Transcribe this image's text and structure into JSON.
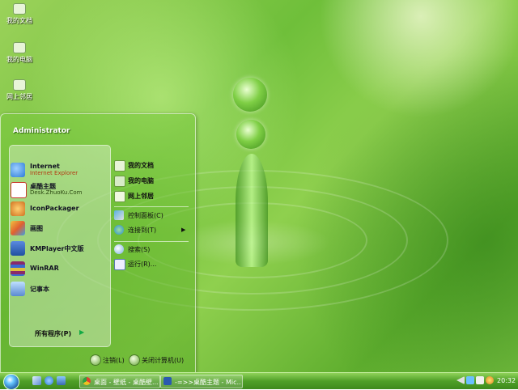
{
  "desktop_icons": [
    {
      "label": "我的文档",
      "icon": "my-documents-icon"
    },
    {
      "label": "我的电脑",
      "icon": "my-computer-icon"
    },
    {
      "label": "网上邻居",
      "icon": "network-places-icon"
    }
  ],
  "start_menu": {
    "user_name": "Administrator",
    "programs": [
      {
        "label": "Internet",
        "sub": "Internet Explorer",
        "icon": "internet-explorer-icon",
        "color": "#2a7ad8"
      },
      {
        "label": "桌酷主题",
        "sub": "Desk.ZhuoKu.Com",
        "icon": "zhuoku-theme-icon",
        "color": "#c93a2a"
      },
      {
        "label": "IconPackager",
        "sub": "",
        "icon": "iconpackager-icon",
        "color": "#d07020"
      },
      {
        "label": "画图",
        "sub": "",
        "icon": "paint-icon",
        "color": "#e0a020"
      },
      {
        "label": "KMPlayer中文版",
        "sub": "",
        "icon": "kmplayer-icon",
        "color": "#2050a0"
      },
      {
        "label": "WinRAR",
        "sub": "",
        "icon": "winrar-icon",
        "color": "#8a2a6a"
      },
      {
        "label": "记事本",
        "sub": "",
        "icon": "notepad-icon",
        "color": "#5a8ad0"
      }
    ],
    "all_programs": "所有程序(P)",
    "places": [
      {
        "label": "我的文档",
        "icon": "my-documents-icon"
      },
      {
        "label": "我的电脑",
        "icon": "my-computer-icon"
      },
      {
        "label": "网上邻居",
        "icon": "network-places-icon"
      }
    ],
    "system": [
      {
        "label": "控制面板(C)",
        "icon": "control-panel-icon"
      },
      {
        "label": "连接到(T)",
        "icon": "connect-to-icon"
      }
    ],
    "tools": [
      {
        "label": "搜索(S)",
        "icon": "search-icon"
      },
      {
        "label": "运行(R)...",
        "icon": "run-icon"
      }
    ],
    "logoff": "注销(L)",
    "shutdown": "关闭计算机(U)"
  },
  "taskbar": {
    "tasks": [
      {
        "label": "桌面 - 壁纸 - 桌酷壁...",
        "icon": "chrome-icon"
      },
      {
        "label": "-=>>桌酷主题 - Mic...",
        "icon": "word-icon"
      }
    ],
    "clock": "20:32"
  },
  "colors": {
    "accent": "#6fbf3a",
    "taskbar": "#4f9f28"
  }
}
